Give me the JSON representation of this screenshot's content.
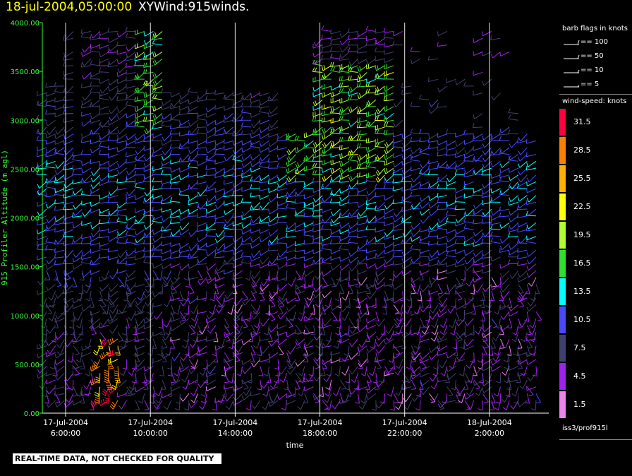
{
  "header": {
    "date": "18-jul-2004,05:00:00",
    "title": "XYWind:915winds."
  },
  "chart_data": {
    "type": "wind-barb-time-height",
    "xlabel": "time",
    "ylabel": "915 Profiler Altitude (m agl)",
    "ylim": [
      0,
      4000
    ],
    "y_ticks": [
      "0.00",
      "500.00",
      "1000.00",
      "1500.00",
      "2000.00",
      "2500.00",
      "3000.00",
      "3500.00",
      "4000.00"
    ],
    "x_ticks": [
      {
        "date": "17-Jul-2004",
        "time": "6:00:00"
      },
      {
        "date": "17-Jul-2004",
        "time": "10:00:00"
      },
      {
        "date": "17-Jul-2004",
        "time": "14:00:00"
      },
      {
        "date": "17-Jul-2004",
        "time": "18:00:00"
      },
      {
        "date": "17-Jul-2004",
        "time": "22:00:00"
      },
      {
        "date": "18-Jul-2004",
        "time": "2:00:00"
      }
    ],
    "x_hours_range": [
      4.9,
      28.8
    ],
    "x_tick_hours": [
      6,
      10,
      14,
      18,
      22,
      26
    ],
    "grid": "vertical lines at x ticks"
  },
  "legend": {
    "barb_title": "barb flags in knots",
    "barb_items": [
      "== 100",
      "== 50",
      "== 10",
      "== 5"
    ],
    "speed_title": "wind-speed: knots",
    "speed_labels": [
      "31.5",
      "28.5",
      "25.5",
      "22.5",
      "19.5",
      "16.5",
      "13.5",
      "10.5",
      "7.5",
      "4.5",
      "1.5"
    ],
    "speed_colors": [
      "#ff0040",
      "#ff8000",
      "#ffb000",
      "#ffff00",
      "#b0ff30",
      "#30e030",
      "#00ffff",
      "#4848ff",
      "#404070",
      "#a020f0",
      "#ee82ee"
    ]
  },
  "station": "iss3/prof915l",
  "footer": "REAL-TIME DATA, NOT CHECKED FOR QUALITY"
}
